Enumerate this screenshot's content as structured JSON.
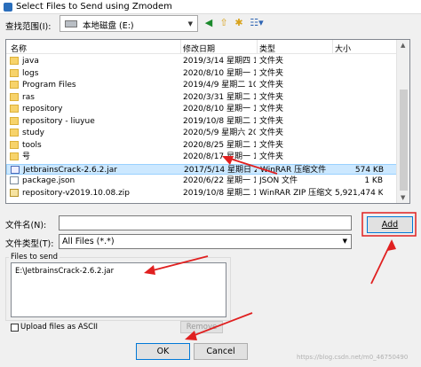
{
  "window": {
    "title": "Select Files to Send using Zmodem"
  },
  "lookin": {
    "label": "查找范围(I):",
    "value": "本地磁盘 (E:)"
  },
  "toolbar_icons": [
    "back-icon",
    "up-folder-icon",
    "new-folder-icon",
    "view-menu-icon"
  ],
  "list": {
    "columns": [
      "名称",
      "修改日期",
      "类型",
      "大小"
    ],
    "rows": [
      {
        "name": "java",
        "date": "2019/3/14 星期四 1...",
        "type": "文件夹",
        "size": "",
        "icon": "folder-icon",
        "selected": false
      },
      {
        "name": "logs",
        "date": "2020/8/10 星期一 1...",
        "type": "文件夹",
        "size": "",
        "icon": "folder-icon",
        "selected": false
      },
      {
        "name": "Program Files",
        "date": "2019/4/9 星期二 10...",
        "type": "文件夹",
        "size": "",
        "icon": "folder-icon",
        "selected": false
      },
      {
        "name": "ras",
        "date": "2020/3/31 星期二 1...",
        "type": "文件夹",
        "size": "",
        "icon": "folder-icon",
        "selected": false
      },
      {
        "name": "repository",
        "date": "2020/8/10 星期一 1...",
        "type": "文件夹",
        "size": "",
        "icon": "folder-icon",
        "selected": false
      },
      {
        "name": "repository - liuyue",
        "date": "2019/10/8 星期二 1...",
        "type": "文件夹",
        "size": "",
        "icon": "folder-icon",
        "selected": false
      },
      {
        "name": "study",
        "date": "2020/5/9 星期六 20...",
        "type": "文件夹",
        "size": "",
        "icon": "folder-icon",
        "selected": false
      },
      {
        "name": "tools",
        "date": "2020/8/25 星期二 1...",
        "type": "文件夹",
        "size": "",
        "icon": "folder-icon",
        "selected": false
      },
      {
        "name": "号",
        "date": "2020/8/17 星期一 1...",
        "type": "文件夹",
        "size": "",
        "icon": "folder-icon",
        "selected": false
      },
      {
        "name": "JetbrainsCrack-2.6.2.jar",
        "date": "2017/5/14 星期日 2...",
        "type": "WinRAR 压缩文件",
        "size": "574 KB",
        "icon": "jar-icon",
        "selected": true
      },
      {
        "name": "package.json",
        "date": "2020/6/22 星期一 1...",
        "type": "JSON 文件",
        "size": "1 KB",
        "icon": "json-file-icon",
        "selected": false
      },
      {
        "name": "repository-v2019.10.08.zip",
        "date": "2019/10/8 星期二 1...",
        "type": "WinRAR ZIP 压缩文件",
        "size": "5,921,474 KB",
        "icon": "zip-icon",
        "selected": false
      }
    ]
  },
  "filename": {
    "label": "文件名(N):",
    "value": ""
  },
  "filetype": {
    "label": "文件类型(T):",
    "value": "All Files (*.*)"
  },
  "buttons": {
    "add": "Add",
    "remove": "Remove",
    "ok": "OK",
    "cancel": "Cancel"
  },
  "files_to_send": {
    "title": "Files to send",
    "items": [
      "E:\\JetbrainsCrack-2.6.2.jar"
    ]
  },
  "ascii_checkbox": {
    "label": "Upload files as ASCII",
    "checked": false
  },
  "watermark": "https://blog.csdn.net/m0_46750490",
  "colors": {
    "selection": "#cce8ff",
    "accent": "#0078d7",
    "annotation": "#e02020"
  }
}
